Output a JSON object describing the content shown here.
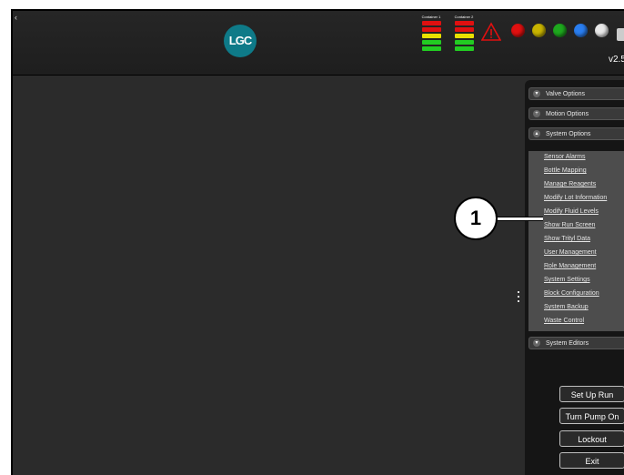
{
  "header": {
    "back_glyph": "‹",
    "logo_text": "LGC",
    "version": "v2.5",
    "containers": [
      {
        "label": "Container 1",
        "bars": [
          "red",
          "red",
          "yellow",
          "green",
          "green"
        ]
      },
      {
        "label": "Container 2",
        "bars": [
          "red",
          "red",
          "yellow",
          "green",
          "green"
        ]
      }
    ],
    "status_lamps": [
      {
        "name": "red",
        "color": "#e01010"
      },
      {
        "name": "yellow",
        "color": "#c8b400"
      },
      {
        "name": "green",
        "color": "#1ea81e"
      },
      {
        "name": "blue",
        "color": "#2a7ef0"
      },
      {
        "name": "white",
        "color": "#e8e8e8"
      }
    ]
  },
  "panel": {
    "sections": {
      "valve": "Valve Options",
      "motion": "Motion Options",
      "system": "System Options",
      "editors": "System Editors"
    },
    "system_items": [
      "Sensor Alarms",
      "Bottle Mapping",
      "Manage Reagents",
      "Modify Lot Information",
      "Modify Fluid Levels",
      "Show Run Screen",
      "Show Trityl Data",
      "User Management",
      "Role Management",
      "System Settings",
      "Block Configuration",
      "System Backup",
      "Waste Control"
    ]
  },
  "buttons": {
    "setup_run": "Set Up Run",
    "turn_pump": "Turn Pump On",
    "lockout": "Lockout",
    "exit": "Exit"
  },
  "callout": "1"
}
